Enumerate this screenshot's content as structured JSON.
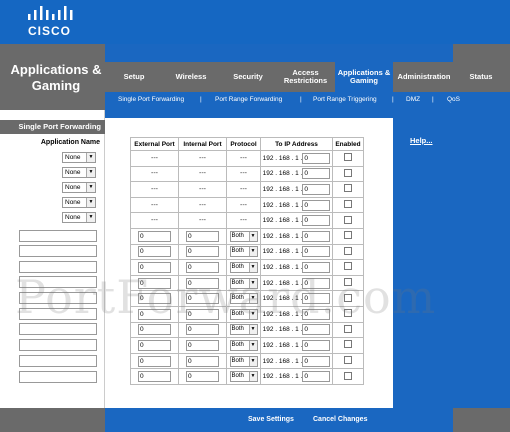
{
  "brand": {
    "logo_text": "CISCO"
  },
  "section_title": "Applications & Gaming",
  "nav": {
    "tabs": [
      {
        "label": "Setup"
      },
      {
        "label": "Wireless"
      },
      {
        "label": "Security"
      },
      {
        "label": "Access Restrictions"
      },
      {
        "label": "Applications & Gaming"
      },
      {
        "label": "Administration"
      },
      {
        "label": "Status"
      }
    ],
    "active_tab_index": 4
  },
  "subnav": {
    "items": [
      {
        "label": "Single Port Forwarding"
      },
      {
        "label": "Port Range Forwarding"
      },
      {
        "label": "Port Range Triggering"
      },
      {
        "label": "DMZ"
      },
      {
        "label": "QoS"
      }
    ],
    "separator": "|"
  },
  "left": {
    "subtitle": "Single Port Forwarding",
    "application_name_label": "Application Name",
    "preset_selects": [
      "None",
      "None",
      "None",
      "None",
      "None"
    ],
    "custom_name_inputs": [
      "",
      "",
      "",
      "",
      "",
      "",
      "",
      "",
      "",
      ""
    ]
  },
  "help": {
    "label": "Help..."
  },
  "table": {
    "headers": [
      "External Port",
      "Internal Port",
      "Protocol",
      "To IP Address",
      "Enabled"
    ],
    "ip_prefix": "192 . 168 . 1 .",
    "dash": "---",
    "preset_rows": [
      {
        "ip_last": "0",
        "enabled": false
      },
      {
        "ip_last": "0",
        "enabled": false
      },
      {
        "ip_last": "0",
        "enabled": false
      },
      {
        "ip_last": "0",
        "enabled": false
      },
      {
        "ip_last": "0",
        "enabled": false
      }
    ],
    "custom_rows": [
      {
        "external": "0",
        "internal": "0",
        "protocol": "Both",
        "ip_last": "0",
        "enabled": false
      },
      {
        "external": "0",
        "internal": "0",
        "protocol": "Both",
        "ip_last": "0",
        "enabled": false
      },
      {
        "external": "0",
        "internal": "0",
        "protocol": "Both",
        "ip_last": "0",
        "enabled": false
      },
      {
        "external": "0",
        "internal": "0",
        "protocol": "Both",
        "ip_last": "0",
        "enabled": false
      },
      {
        "external": "0",
        "internal": "0",
        "protocol": "Both",
        "ip_last": "0",
        "enabled": false
      },
      {
        "external": "0",
        "internal": "0",
        "protocol": "Both",
        "ip_last": "0",
        "enabled": false
      },
      {
        "external": "0",
        "internal": "0",
        "protocol": "Both",
        "ip_last": "0",
        "enabled": false
      },
      {
        "external": "0",
        "internal": "0",
        "protocol": "Both",
        "ip_last": "0",
        "enabled": false
      },
      {
        "external": "0",
        "internal": "0",
        "protocol": "Both",
        "ip_last": "0",
        "enabled": false
      },
      {
        "external": "0",
        "internal": "0",
        "protocol": "Both",
        "ip_last": "0",
        "enabled": false
      }
    ]
  },
  "buttons": {
    "save": "Save Settings",
    "cancel": "Cancel Changes"
  },
  "watermark": "PortForward.com",
  "colors": {
    "brand_blue": "#1a67c1",
    "nav_gray": "#6a6a6a"
  }
}
